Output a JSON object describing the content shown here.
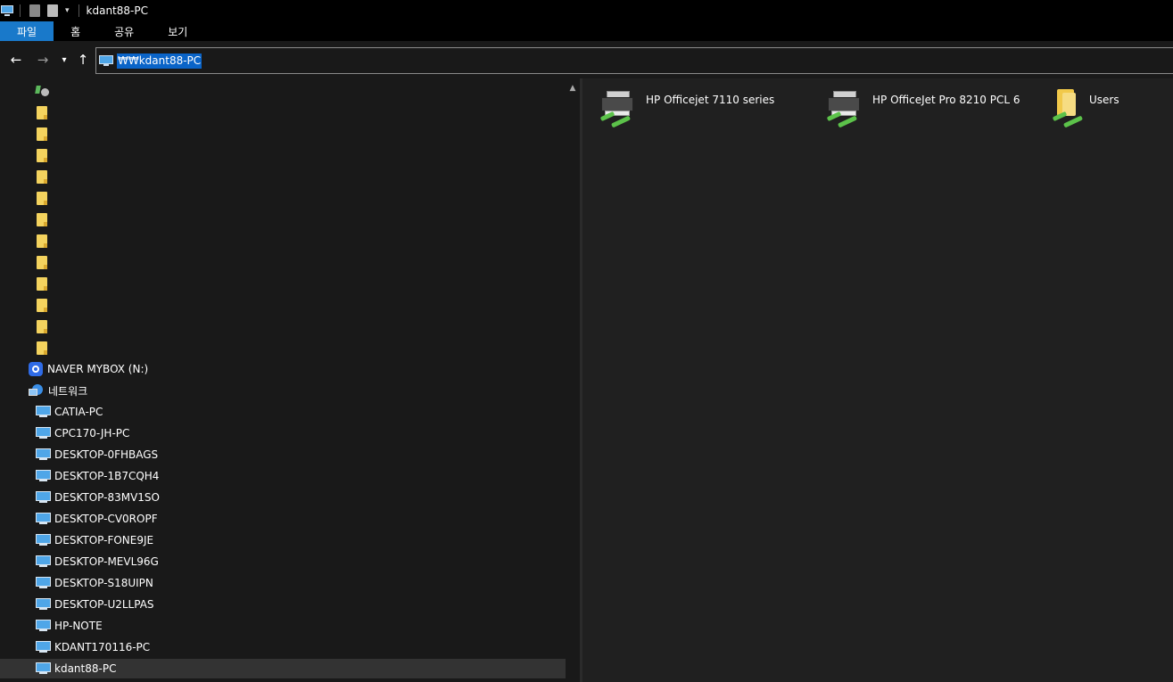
{
  "window": {
    "title": "kdant88-PC"
  },
  "ribbon": {
    "tabs": [
      "파일",
      "홈",
      "공유",
      "보기"
    ]
  },
  "address": {
    "path": "₩₩kdant88-PC"
  },
  "navpane": {
    "network_label": "네트워크",
    "mybox_label": "NAVER MYBOX (N:)",
    "computers": [
      "CATIA-PC",
      "CPC170-JH-PC",
      "DESKTOP-0FHBAGS",
      "DESKTOP-1B7CQH4",
      "DESKTOP-83MV1SO",
      "DESKTOP-CV0ROPF",
      "DESKTOP-FONE9JE",
      "DESKTOP-MEVL96G",
      "DESKTOP-S18UIPN",
      "DESKTOP-U2LLPAS",
      "HP-NOTE",
      "KDANT170116-PC",
      "kdant88-PC"
    ]
  },
  "content": {
    "items": [
      {
        "label": "HP Officejet 7110 series",
        "icon": "network-printer-icon"
      },
      {
        "label": "HP OfficeJet Pro 8210 PCL 6",
        "icon": "network-printer-icon"
      },
      {
        "label": "Users",
        "icon": "shared-folder-icon"
      }
    ]
  },
  "colors": {
    "accent": "#1979ca",
    "selection": "#0a64c8",
    "background": "#191919"
  }
}
